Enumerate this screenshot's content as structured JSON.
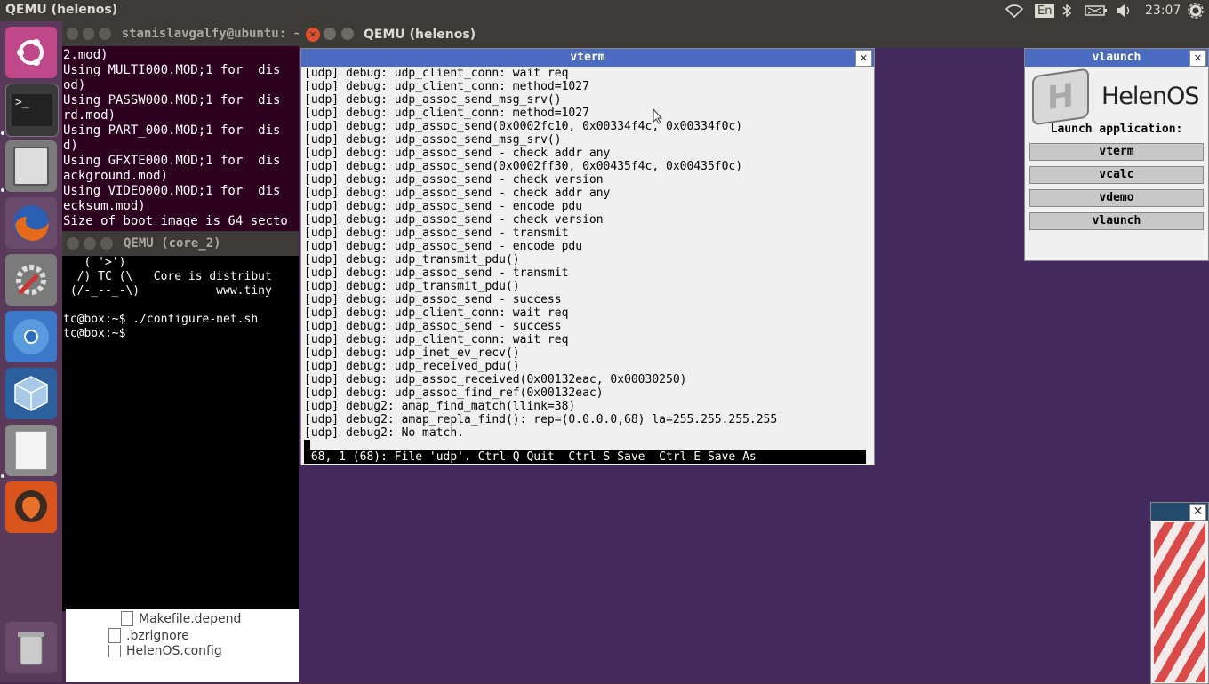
{
  "panel": {
    "title": "QEMU (helenos)",
    "keyboard": "En",
    "time": "23:07"
  },
  "launcher": {
    "items": [
      {
        "name": "ubuntu-dash-icon"
      },
      {
        "name": "terminal-icon"
      },
      {
        "name": "files-icon"
      },
      {
        "name": "firefox-icon"
      },
      {
        "name": "settings-icon"
      },
      {
        "name": "chromium-icon"
      },
      {
        "name": "virtualbox-icon"
      },
      {
        "name": "text-editor-icon"
      },
      {
        "name": "qemu-icon"
      },
      {
        "name": "trash-icon"
      }
    ]
  },
  "term1": {
    "title": "stanislavgalfy@ubuntu: ~/",
    "lines": [
      "2.mod)",
      "Using MULTI000.MOD;1 for  dis",
      "od)",
      "Using PASSW000.MOD;1 for  dis",
      "rd.mod)",
      "Using PART_000.MOD;1 for  dis",
      "d)",
      "Using GFXTE000.MOD;1 for  dis",
      "ackground.mod)",
      "Using VIDEO000.MOD;1 for  dis",
      "ecksum.mod)",
      "Size of boot image is 64 secto"
    ]
  },
  "term2": {
    "title": "QEMU (core_2)",
    "lines": [
      "   ( '>')",
      "  /) TC (\\   Core is distribut",
      " (/-_--_-\\)           www.tiny",
      "",
      "tc@box:~$ ./configure-net.sh",
      "tc@box:~$"
    ]
  },
  "files": {
    "items": [
      "Makefile.depend",
      ".bzrignore",
      "HelenOS.config"
    ]
  },
  "qemu": {
    "title": "QEMU (helenos)"
  },
  "vterm": {
    "title": "vterm",
    "lines": [
      "[udp] debug: udp_client_conn: wait req",
      "[udp] debug: udp_client_conn: method=1027",
      "[udp] debug: udp_assoc_send_msg_srv()",
      "[udp] debug: udp_client_conn: method=1027",
      "[udp] debug: udp_assoc_send(0x0002fc10, 0x00334f4c, 0x00334f0c)",
      "[udp] debug: udp_assoc_send_msg_srv()",
      "[udp] debug: udp_assoc_send - check addr any",
      "[udp] debug: udp_assoc_send(0x0002ff30, 0x00435f4c, 0x00435f0c)",
      "[udp] debug: udp_assoc_send - check version",
      "[udp] debug: udp_assoc_send - check addr any",
      "[udp] debug: udp_assoc_send - encode pdu",
      "[udp] debug: udp_assoc_send - check version",
      "[udp] debug: udp_assoc_send - transmit",
      "[udp] debug: udp_assoc_send - encode pdu",
      "[udp] debug: udp_transmit_pdu()",
      "[udp] debug: udp_assoc_send - transmit",
      "[udp] debug: udp_transmit_pdu()",
      "[udp] debug: udp_assoc_send - success",
      "[udp] debug: udp_client_conn: wait req",
      "[udp] debug: udp_assoc_send - success",
      "[udp] debug: udp_client_conn: wait req",
      "[udp] debug: udp_inet_ev_recv()",
      "[udp] debug: udp_received_pdu()",
      "[udp] debug: udp_assoc_received(0x00132eac, 0x00030250)",
      "[udp] debug: udp_assoc_find_ref(0x00132eac)",
      "[udp] debug2: amap_find_match(llink=38)",
      "[udp] debug2: amap_repla_find(): rep=(0.0.0.0,68) la=255.255.255.255",
      "[udp] debug2: No match."
    ],
    "status": " 68, 1 (68): File 'udp'. Ctrl-Q Quit  Ctrl-S Save  Ctrl-E Save As"
  },
  "vlaunch": {
    "title": "vlaunch",
    "logo_text": "HelenOS",
    "prompt": "Launch application:",
    "buttons": [
      "vterm",
      "vcalc",
      "vdemo",
      "vlaunch"
    ]
  },
  "colors": {
    "qemu_bg": "#43295c",
    "vterm_title": "#4a6bc0",
    "terminal_bg": "#2c001e"
  }
}
